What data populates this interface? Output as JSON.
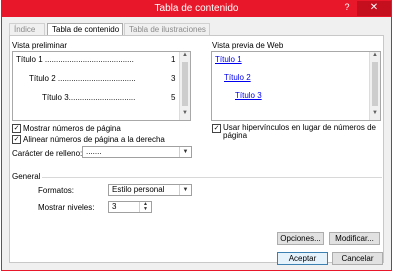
{
  "window": {
    "title": "Tabla de contenido",
    "help_icon": "?",
    "close_icon": "✕"
  },
  "tabs": [
    {
      "label": "Índice"
    },
    {
      "label": "Tabla de contenido"
    },
    {
      "label": "Tabla de ilustraciones"
    }
  ],
  "print_preview": {
    "label": "Vista preliminar",
    "entries": [
      {
        "text": "Título 1 ........................................",
        "page": "1"
      },
      {
        "text": "Título 2 ...................................",
        "page": "3"
      },
      {
        "text": "Título 3..............................",
        "page": "5"
      }
    ]
  },
  "web_preview": {
    "label": "Vista previa de Web",
    "entries": [
      "Título 1",
      "Título 2",
      "Título 3"
    ]
  },
  "options": {
    "show_page_numbers": "Mostrar números de página",
    "align_right": "Alinear números de página a la derecha",
    "fill_char_label": "Carácter de relleno:",
    "fill_char_value": ".......",
    "hyperlinks": "Usar hipervínculos en lugar de números de página"
  },
  "general": {
    "label": "General",
    "formats_label": "Formatos:",
    "formats_value": "Estilo personal",
    "levels_label": "Mostrar niveles:",
    "levels_value": "3"
  },
  "buttons": {
    "options": "Opciones...",
    "modify": "Modificar...",
    "accept": "Aceptar",
    "cancel": "Cancelar"
  },
  "colors": {
    "titlebar": "#e8182a",
    "link": "#0000ee"
  }
}
